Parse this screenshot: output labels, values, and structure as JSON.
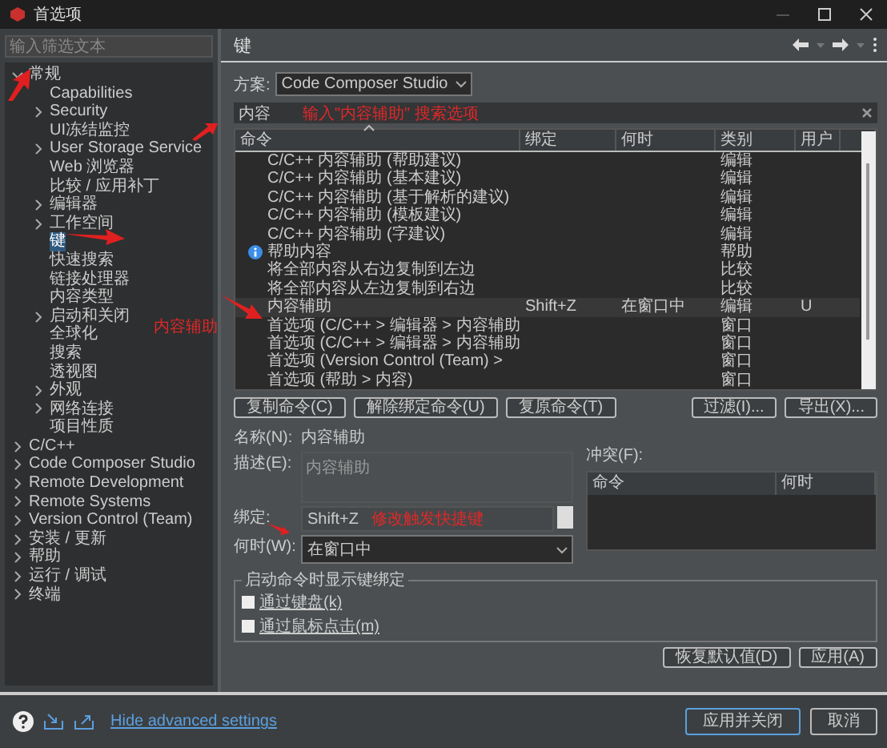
{
  "window": {
    "title": "首选项"
  },
  "filter": {
    "placeholder": "输入筛选文本"
  },
  "tree": [
    {
      "label": "常规",
      "kind": "group",
      "expanded": true,
      "selected": false,
      "children": [
        {
          "label": "Capabilities",
          "kind": "leaf",
          "selected": false
        },
        {
          "label": "Security",
          "kind": "group",
          "expanded": false,
          "selected": false
        },
        {
          "label": "UI冻结监控",
          "kind": "leaf",
          "selected": false
        },
        {
          "label": "User Storage Service",
          "kind": "group",
          "expanded": false,
          "selected": false
        },
        {
          "label": "Web 浏览器",
          "kind": "leaf",
          "selected": false
        },
        {
          "label": "比较 / 应用补丁",
          "kind": "leaf",
          "selected": false
        },
        {
          "label": "编辑器",
          "kind": "group",
          "expanded": false,
          "selected": false
        },
        {
          "label": "工作空间",
          "kind": "group",
          "expanded": false,
          "selected": false
        },
        {
          "label": "键",
          "kind": "leaf",
          "selected": true
        },
        {
          "label": "快速搜索",
          "kind": "leaf",
          "selected": false
        },
        {
          "label": "链接处理器",
          "kind": "leaf",
          "selected": false
        },
        {
          "label": "内容类型",
          "kind": "leaf",
          "selected": false
        },
        {
          "label": "启动和关闭",
          "kind": "group",
          "expanded": false,
          "selected": false
        },
        {
          "label": "全球化",
          "kind": "leaf",
          "selected": false
        },
        {
          "label": "搜索",
          "kind": "leaf",
          "selected": false
        },
        {
          "label": "透视图",
          "kind": "leaf",
          "selected": false
        },
        {
          "label": "外观",
          "kind": "group",
          "expanded": false,
          "selected": false
        },
        {
          "label": "网络连接",
          "kind": "group",
          "expanded": false,
          "selected": false
        },
        {
          "label": "项目性质",
          "kind": "leaf",
          "selected": false
        }
      ]
    },
    {
      "label": "C/C++",
      "kind": "group",
      "expanded": false,
      "selected": false
    },
    {
      "label": "Code Composer Studio",
      "kind": "group",
      "expanded": false,
      "selected": false
    },
    {
      "label": "Remote Development",
      "kind": "group",
      "expanded": false,
      "selected": false
    },
    {
      "label": "Remote Systems",
      "kind": "group",
      "expanded": false,
      "selected": false
    },
    {
      "label": "Version Control (Team)",
      "kind": "group",
      "expanded": false,
      "selected": false
    },
    {
      "label": "安装 / 更新",
      "kind": "group",
      "expanded": false,
      "selected": false
    },
    {
      "label": "帮助",
      "kind": "group",
      "expanded": false,
      "selected": false
    },
    {
      "label": "运行 / 调试",
      "kind": "group",
      "expanded": false,
      "selected": false
    },
    {
      "label": "终端",
      "kind": "group",
      "expanded": false,
      "selected": false
    }
  ],
  "page": {
    "title": "键",
    "scheme_label": "方案:",
    "scheme": "Code Composer Studio",
    "search": "内容",
    "columns": [
      "命令",
      "绑定",
      "何时",
      "类别",
      "用户"
    ],
    "rows": [
      {
        "command": "C/C++ 内容辅助 (帮助建议)",
        "binding": "",
        "when": "",
        "category": "编辑",
        "user": "",
        "kind": "plain",
        "selected": false
      },
      {
        "command": "C/C++ 内容辅助 (基本建议)",
        "binding": "",
        "when": "",
        "category": "编辑",
        "user": "",
        "kind": "plain",
        "selected": false
      },
      {
        "command": "C/C++ 内容辅助 (基于解析的建议)",
        "binding": "",
        "when": "",
        "category": "编辑",
        "user": "",
        "kind": "plain",
        "selected": false
      },
      {
        "command": "C/C++ 内容辅助 (模板建议)",
        "binding": "",
        "when": "",
        "category": "编辑",
        "user": "",
        "kind": "plain",
        "selected": false
      },
      {
        "command": "C/C++ 内容辅助 (字建议)",
        "binding": "",
        "when": "",
        "category": "编辑",
        "user": "",
        "kind": "plain",
        "selected": false
      },
      {
        "command": "帮助内容",
        "binding": "",
        "when": "",
        "category": "帮助",
        "user": "",
        "kind": "help",
        "selected": false
      },
      {
        "command": "将全部内容从右边复制到左边",
        "binding": "",
        "when": "",
        "category": "比较",
        "user": "",
        "kind": "plain",
        "selected": false
      },
      {
        "command": "将全部内容从左边复制到右边",
        "binding": "",
        "when": "",
        "category": "比较",
        "user": "",
        "kind": "plain",
        "selected": false
      },
      {
        "command": "内容辅助",
        "binding": "Shift+Z",
        "when": "在窗口中",
        "category": "编辑",
        "user": "U",
        "kind": "plain",
        "selected": true
      },
      {
        "command": "首选项 (C/C++ > 编辑器 > 内容辅助",
        "binding": "",
        "when": "",
        "category": "窗口",
        "user": "",
        "kind": "plain",
        "selected": false
      },
      {
        "command": "首选项 (C/C++ > 编辑器 > 内容辅助",
        "binding": "",
        "when": "",
        "category": "窗口",
        "user": "",
        "kind": "plain",
        "selected": false
      },
      {
        "command": "首选项 (Version Control (Team) >",
        "binding": "",
        "when": "",
        "category": "窗口",
        "user": "",
        "kind": "plain",
        "selected": false
      },
      {
        "command": "首选项 (帮助 > 内容)",
        "binding": "",
        "when": "",
        "category": "窗口",
        "user": "",
        "kind": "plain",
        "selected": false
      }
    ],
    "table_buttons": [
      "复制命令(C)",
      "解除绑定命令(U)",
      "复原命令(T)"
    ],
    "right_buttons": [
      "过滤(I)...",
      "导出(X)..."
    ],
    "name_label": "名称(N):",
    "name": "内容辅助",
    "description_label": "描述(E):",
    "description": "内容辅助",
    "binding_label": "绑定:",
    "binding": "Shift+Z",
    "when_label": "何时(W):",
    "when": "在窗口中",
    "conflicts_label": "冲突(F):",
    "conflict_columns": [
      "命令",
      "何时"
    ],
    "group": {
      "title": "启动命令时显示键绑定",
      "options": [
        {
          "label": "通过键盘(k)",
          "checked": false
        },
        {
          "label": "通过鼠标点击(m)",
          "checked": false
        }
      ]
    },
    "bottom_buttons": [
      "恢复默认值(D)",
      "应用(A)"
    ]
  },
  "annotations": [
    "输入\"内容辅助\" 搜索选项",
    "内容辅助",
    "修改触发快捷键"
  ],
  "footer": {
    "link": "Hide advanced settings",
    "buttons": [
      "应用并关闭",
      "取消"
    ]
  }
}
